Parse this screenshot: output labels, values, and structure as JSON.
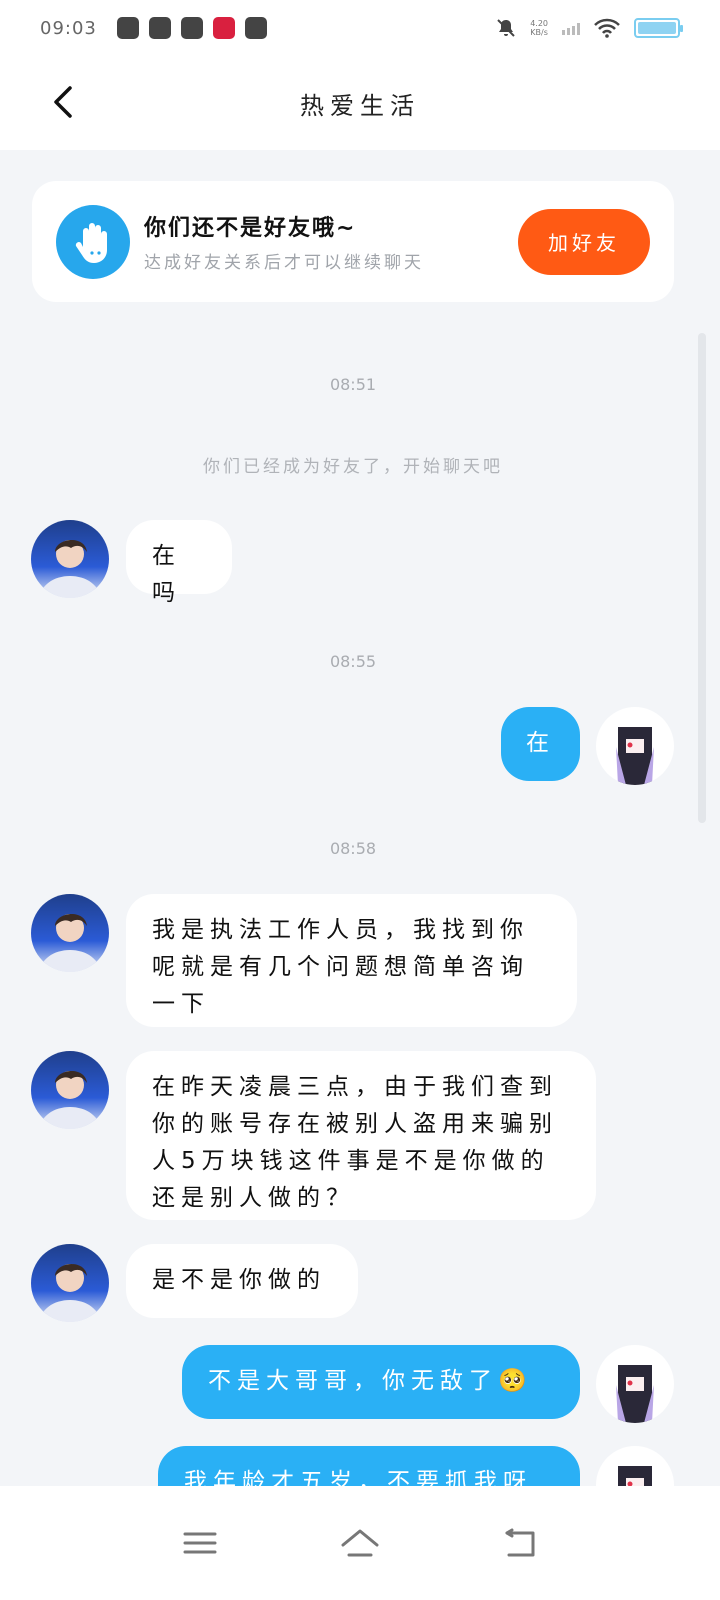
{
  "status_bar": {
    "time": "09:03",
    "net_speed_value": "4.20",
    "net_speed_unit": "KB/s",
    "battery_level": 1.0
  },
  "header": {
    "title": "热爱生活"
  },
  "notice": {
    "title": "你们还不是好友哦~",
    "subtitle": "达成好友关系后才可以继续聊天",
    "button_label": "加好友"
  },
  "chat": {
    "timestamps": [
      "08:51",
      "08:55",
      "08:58"
    ],
    "system_message": "你们已经成为好友了，开始聊天吧",
    "messages": [
      {
        "sender": "other",
        "text": "在吗"
      },
      {
        "sender": "me",
        "text": "在"
      },
      {
        "sender": "other",
        "text": "我是执法工作人员，我找到你呢就是有几个问题想简单咨询一下"
      },
      {
        "sender": "other",
        "text": "在昨天凌晨三点，由于我们查到你的账号存在被别人盗用来骗别人5万块钱这件事是不是你做的还是别人做的？"
      },
      {
        "sender": "other",
        "text": "是不是你做的"
      },
      {
        "sender": "me",
        "text": "不是大哥哥，你无敌了🥺"
      },
      {
        "sender": "me",
        "text": "我年龄才五岁，不要抓我呀"
      }
    ]
  },
  "colors": {
    "accent_blue": "#2ab0f5",
    "add_button_orange": "#ff5a14",
    "background": "#f3f5f8"
  }
}
